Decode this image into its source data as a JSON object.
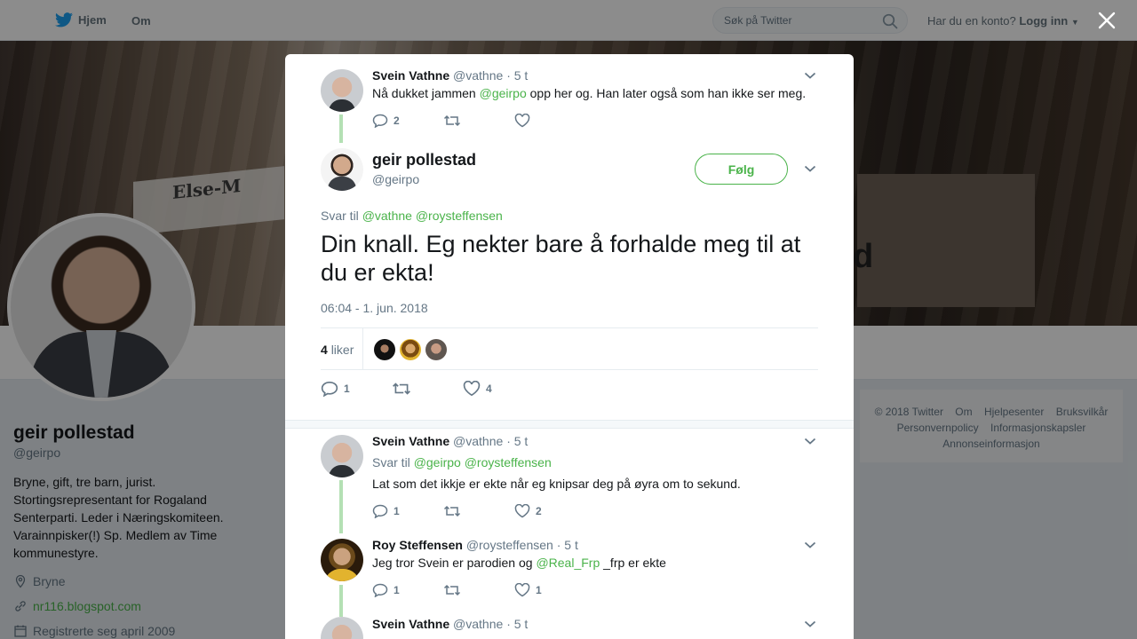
{
  "nav": {
    "home": "Hjem",
    "about": "Om",
    "search_placeholder": "Søk på Twitter",
    "account_question": "Har du en konto?",
    "login": "Logg inn"
  },
  "banner": {
    "sign_text": "Else-M",
    "d_text": "d"
  },
  "profile": {
    "name": "geir pollestad",
    "handle": "@geirpo",
    "bio": "Bryne, gift, tre barn, jurist. Stortingsrepresentant for Rogaland Senterparti. Leder i Næringskomiteen. Varainnpisker(!) Sp. Medlem av Time kommunestyre.",
    "location": "Bryne",
    "url": "nr116.blogspot.com",
    "joined": "Registrerte seg april 2009"
  },
  "footer": {
    "items": [
      "© 2018 Twitter",
      "Om",
      "Hjelpesenter",
      "Bruksvilkår",
      "Personvernpolicy",
      "Informasjonskapsler",
      "Annonseinformasjon"
    ]
  },
  "parent_tweet": {
    "name": "Svein Vathne",
    "handle": "@vathne",
    "time": "· 5 t",
    "text_before": "Nå dukket jammen ",
    "mention": "@geirpo",
    "text_after": " opp her og. Han later også som han ikke ser meg.",
    "reply_count": "2",
    "retweet_count": "",
    "like_count": ""
  },
  "main_tweet": {
    "name": "geir pollestad",
    "handle": "@geirpo",
    "follow": "Følg",
    "reply_to_label": "Svar til",
    "reply_to_1": "@vathne",
    "reply_to_2": "@roysteffensen",
    "text": "Din knall. Eg nekter bare å forhalde meg til at du er ekta!",
    "timestamp": "06:04 - 1. jun. 2018",
    "likes_number": "4",
    "likes_label": "liker",
    "reply_count": "1",
    "retweet_count": "",
    "like_count": "4"
  },
  "replies": [
    {
      "name": "Svein Vathne",
      "handle": "@vathne",
      "time": "· 5 t",
      "reply_to_label": "Svar til",
      "reply_to_1": "@geirpo",
      "reply_to_2": "@roysteffensen",
      "text": "Lat som det ikkje er ekte når eg knipsar deg på øyra om to sekund.",
      "reply_count": "1",
      "retweet_count": "",
      "like_count": "2"
    },
    {
      "name": "Roy Steffensen",
      "handle": "@roysteffensen",
      "time": "· 5 t",
      "text_before": "Jeg tror Svein er parodien og ",
      "mention": "@Real_Frp",
      "text_after": " _frp er ekte",
      "reply_count": "1",
      "retweet_count": "",
      "like_count": "1"
    },
    {
      "name": "Svein Vathne",
      "handle": "@vathne",
      "time": "· 5 t"
    }
  ],
  "colors": {
    "accent": "#4ab34a",
    "muted": "#657786",
    "text": "#14171a"
  }
}
